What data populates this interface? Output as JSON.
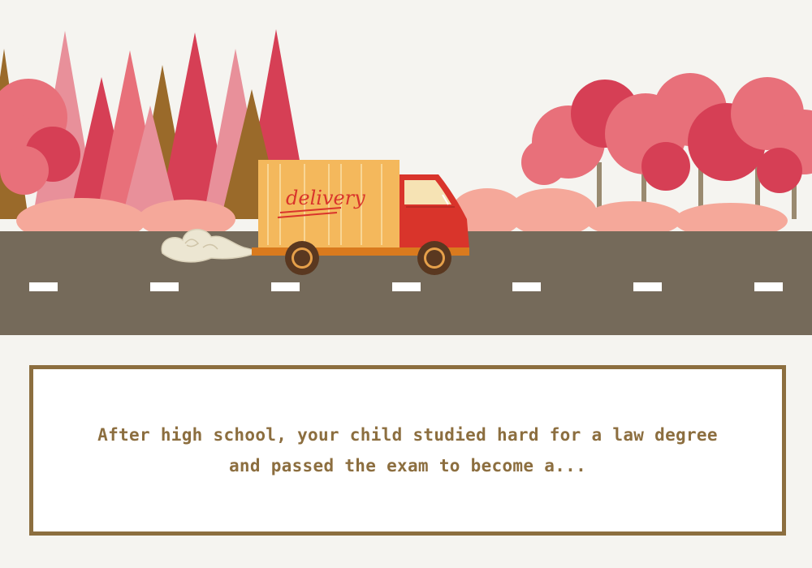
{
  "scene": {
    "truck_label": "delivery",
    "colors": {
      "sky": "#f5f4f0",
      "road": "#756a5a",
      "lane_mark": "#ffffff",
      "truck_box": "#f4b85c",
      "truck_cab": "#d9342b",
      "tree_pink": "#e8707a",
      "tree_red": "#d63f55",
      "tree_brown": "#9a6a2a",
      "bush": "#f5a89a"
    }
  },
  "dialog": {
    "line1": "After high school, your child studied hard for a law degree",
    "line2": "and passed the exam to become a...",
    "text_color": "#8c6e3f",
    "border_color": "#8c6e3f"
  }
}
